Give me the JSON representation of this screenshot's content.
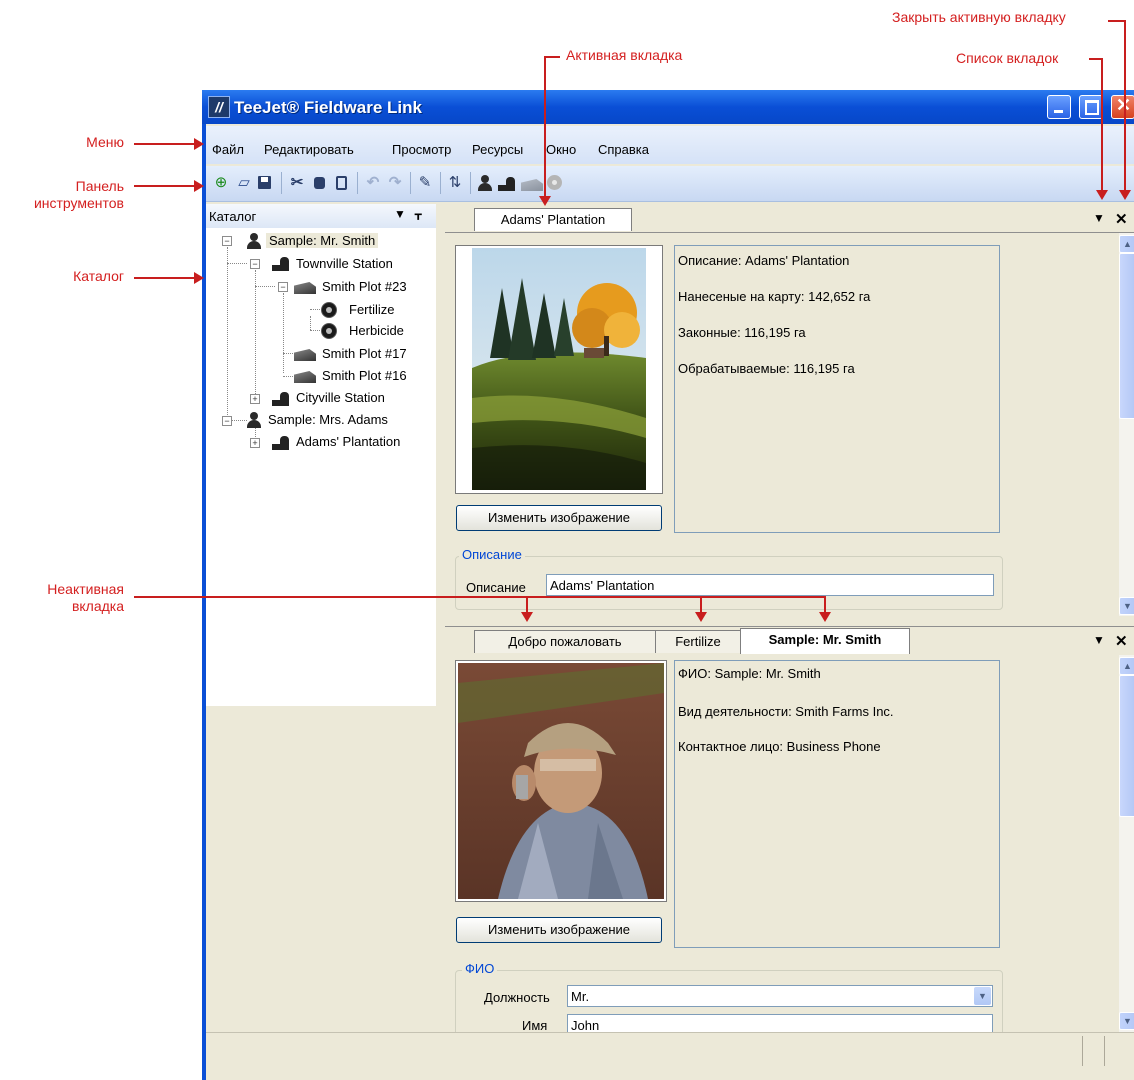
{
  "window": {
    "title": "TeeJet® Fieldware Link",
    "logo_letter": "//"
  },
  "menu": [
    "Файл",
    "Редактировать",
    "Просмотр",
    "Ресурсы",
    "Окно",
    "Справка"
  ],
  "toolbar": {
    "icons": [
      "new-icon",
      "open-folder-icon",
      "save-icon",
      "cut-icon",
      "copy-icon",
      "paste-icon",
      "undo-icon",
      "redo-icon",
      "edit-icon",
      "import-export-icon",
      "customer-icon",
      "farm-icon",
      "field-icon",
      "task-icon"
    ]
  },
  "catalog": {
    "title": "Каталог",
    "tree": [
      {
        "label": "Sample: Mr. Smith",
        "type": "person",
        "selected": true
      },
      {
        "label": "Townville Station",
        "type": "farm"
      },
      {
        "label": "Smith Plot #23",
        "type": "field"
      },
      {
        "label": "Fertilize",
        "type": "task"
      },
      {
        "label": "Herbicide",
        "type": "task"
      },
      {
        "label": "Smith Plot #17",
        "type": "field"
      },
      {
        "label": "Smith Plot #16",
        "type": "field"
      },
      {
        "label": "Cityville Station",
        "type": "farm"
      },
      {
        "label": "Sample: Mrs. Adams",
        "type": "person"
      },
      {
        "label": "Adams' Plantation",
        "type": "farm"
      }
    ]
  },
  "top_doc": {
    "tabs": [
      {
        "label": "Adams' Plantation",
        "active": true
      }
    ],
    "info": [
      "Описание: Adams' Plantation",
      "Нанесеные на карту: 142,652 га",
      "Законные: 116,195 га",
      "Обрабатываемые: 116,195 га"
    ],
    "change_image": "Изменить изображение",
    "group_title": "Описание",
    "field_label": "Описание",
    "field_value": "Adams' Plantation"
  },
  "bottom_doc": {
    "tabs": [
      {
        "label": "Добро пожаловать",
        "active": false
      },
      {
        "label": "Fertilize",
        "active": false
      },
      {
        "label": "Sample: Mr. Smith",
        "active": true
      }
    ],
    "info": [
      "ФИО: Sample: Mr. Smith",
      "Вид деятельности: Smith Farms Inc.",
      "Контактное лицо: Business Phone"
    ],
    "change_image": "Изменить изображение",
    "group_title": "ФИО",
    "title_label": "Должность",
    "title_value": "Mr.",
    "name_label": "Имя",
    "name_value": "John"
  },
  "tab_controls": {
    "list_icon": "▼",
    "close_icon": "✕"
  },
  "annotations": {
    "menu": "Меню",
    "toolbar": "Панель\nинструментов",
    "catalog": "Каталог",
    "inactive_tab": "Неактивная\nвкладка",
    "active_tab": "Активная вкладка",
    "tab_list": "Список вкладок",
    "close_active_tab": "Закрыть активную вкладку"
  },
  "colors": {
    "annotation": "#d42020",
    "titlebar": "#0a4fd6",
    "group_title": "#0046d5"
  }
}
